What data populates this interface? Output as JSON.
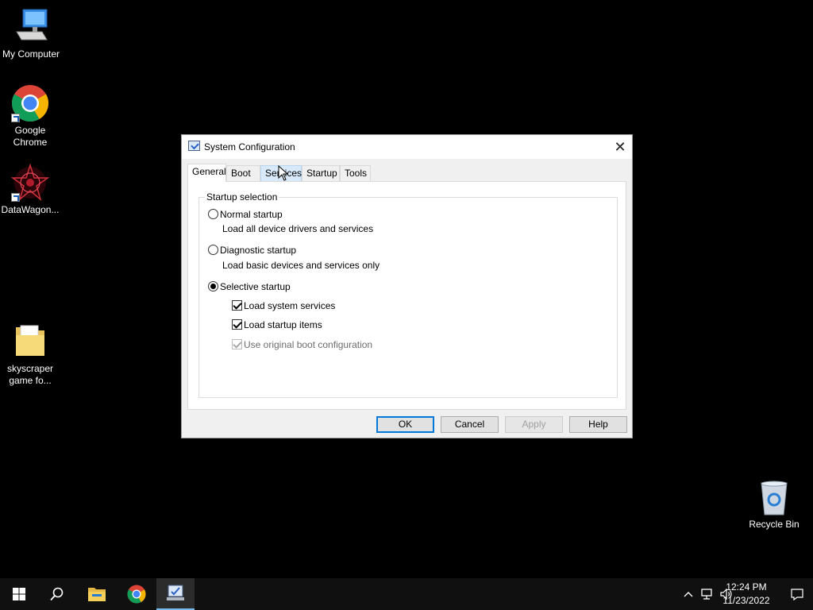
{
  "desktop": {
    "icons": [
      {
        "label": "My Computer"
      },
      {
        "label": "Google Chrome"
      },
      {
        "label": "DataWagon..."
      },
      {
        "label": "skyscraper game fo..."
      },
      {
        "label": "Recycle Bin"
      }
    ]
  },
  "dialog": {
    "title": "System Configuration",
    "close_icon": "✕",
    "tabs": [
      {
        "label": "General",
        "active": true
      },
      {
        "label": "Boot",
        "active": false
      },
      {
        "label": "Services",
        "active": false
      },
      {
        "label": "Startup",
        "active": false
      },
      {
        "label": "Tools",
        "active": false
      }
    ],
    "group_title": "Startup selection",
    "options": {
      "normal": {
        "label": "Normal startup",
        "description": "Load all device drivers and services",
        "selected": false
      },
      "diagnostic": {
        "label": "Diagnostic startup",
        "description": "Load basic devices and services only",
        "selected": false
      },
      "selective": {
        "label": "Selective startup",
        "selected": true
      }
    },
    "checks": {
      "system_services": {
        "label": "Load system services",
        "checked": true,
        "enabled": true
      },
      "startup_items": {
        "label": "Load startup items",
        "checked": true,
        "enabled": true
      },
      "original_boot": {
        "label": "Use original boot configuration",
        "checked": true,
        "enabled": false
      }
    },
    "buttons": {
      "ok": "OK",
      "cancel": "Cancel",
      "apply": "Apply",
      "help": "Help"
    }
  },
  "taskbar": {
    "time": "12:24 PM",
    "date": "11/23/2022"
  },
  "colors": {
    "desktop_background": "#000000",
    "accent": "#0078d7",
    "taskbar": "#101010"
  }
}
